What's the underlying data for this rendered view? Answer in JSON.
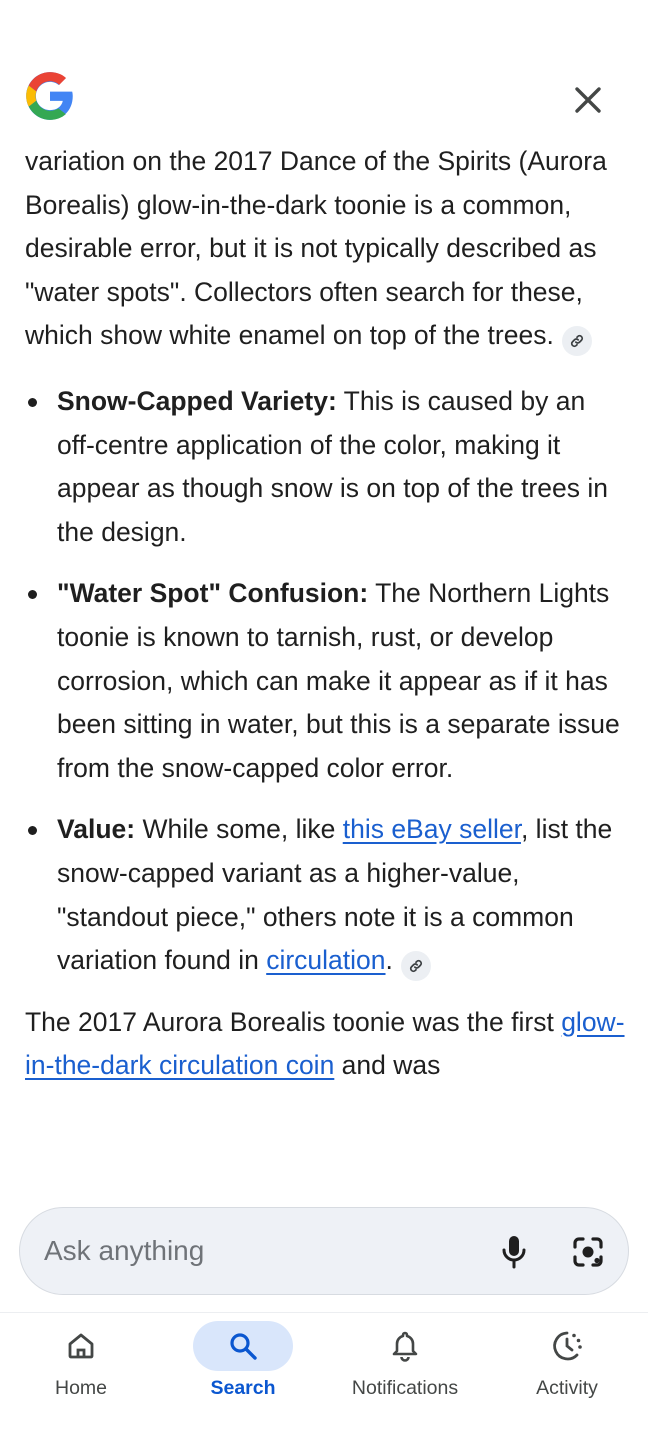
{
  "header": {
    "logo_icon": "google-g-logo",
    "close_icon": "close-icon"
  },
  "answer": {
    "intro": "variation on the 2017 Dance of the Spirits (Aurora Borealis) glow-in-the-dark toonie is a common, desirable error, but it is not typically described as \"water spots\". Collectors often search for these, which show white enamel on top of the trees.",
    "bullets": [
      {
        "title": "Snow-Capped Variety:",
        "text": " This is caused by an off-centre application of the color, making it appear as though snow is on top of the trees in the design."
      },
      {
        "title": "\"Water Spot\" Confusion:",
        "text": " The Northern Lights toonie is known to tarnish, rust, or develop corrosion, which can make it appear as if it has been sitting in water, but this is a separate issue from the snow-capped color error."
      },
      {
        "title": "Value:",
        "text_before_link": " While some, like ",
        "link1": "this eBay seller",
        "text_mid": ", list the snow-capped variant as a higher-value, \"standout piece,\" others note it is a common variation found in ",
        "link2": "circulation",
        "text_after": "."
      }
    ],
    "closing_before_link": "The 2017 Aurora Borealis toonie was the first ",
    "closing_link": "glow-in-the-dark circulation coin",
    "closing_after": " and was"
  },
  "ask": {
    "placeholder": "Ask anything",
    "mic_icon": "microphone-icon",
    "lens_icon": "lens-camera-icon"
  },
  "nav": {
    "items": [
      {
        "label": "Home",
        "icon": "home-icon",
        "active": false
      },
      {
        "label": "Search",
        "icon": "search-icon",
        "active": true
      },
      {
        "label": "Notifications",
        "icon": "bell-icon",
        "active": false
      },
      {
        "label": "Activity",
        "icon": "activity-icon",
        "active": false
      }
    ]
  },
  "colors": {
    "link": "#1a5fcf",
    "active_nav": "#0b57d0",
    "active_pill": "#d9e6fb",
    "ask_bar_bg": "#eef1f6"
  }
}
